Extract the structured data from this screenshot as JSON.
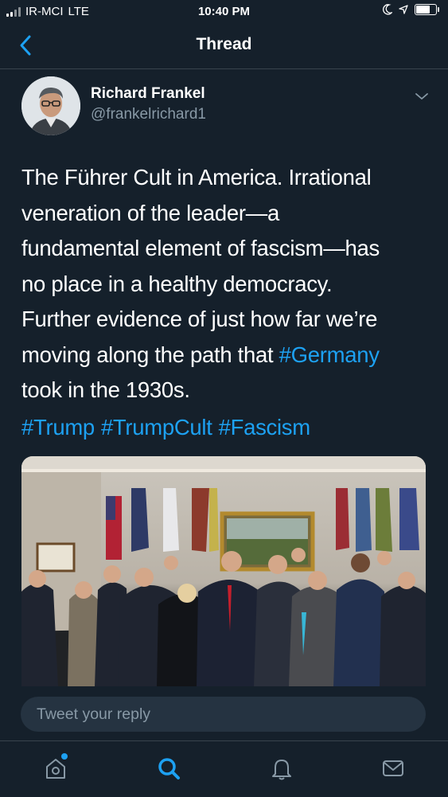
{
  "status_bar": {
    "carrier": "IR-MCI",
    "network": "LTE",
    "time": "10:40 PM",
    "battery_level": 0.65
  },
  "nav": {
    "title": "Thread"
  },
  "tweet": {
    "author_name": "Richard Frankel",
    "author_handle": "@frankelrichard1",
    "text_lines": [
      "The Führer Cult in America. Irrational",
      "veneration of the leader—a",
      "fundamental element of fascism—has",
      "no place in a healthy democracy.",
      "Further evidence of just how far we’re",
      "moving along the path that ",
      "took in the 1930s."
    ],
    "inline_hashtag": "#Germany",
    "hashtags": [
      "#Trump",
      "#TrumpCult",
      "#Fascism"
    ]
  },
  "reply": {
    "placeholder": "Tweet your reply"
  },
  "tabs": [
    {
      "name": "home-icon"
    },
    {
      "name": "search-icon"
    },
    {
      "name": "notifications-icon"
    },
    {
      "name": "messages-icon"
    }
  ],
  "colors": {
    "background": "#15202b",
    "link": "#1da1f2",
    "secondary_text": "#8899a6",
    "divider": "#38444d"
  }
}
